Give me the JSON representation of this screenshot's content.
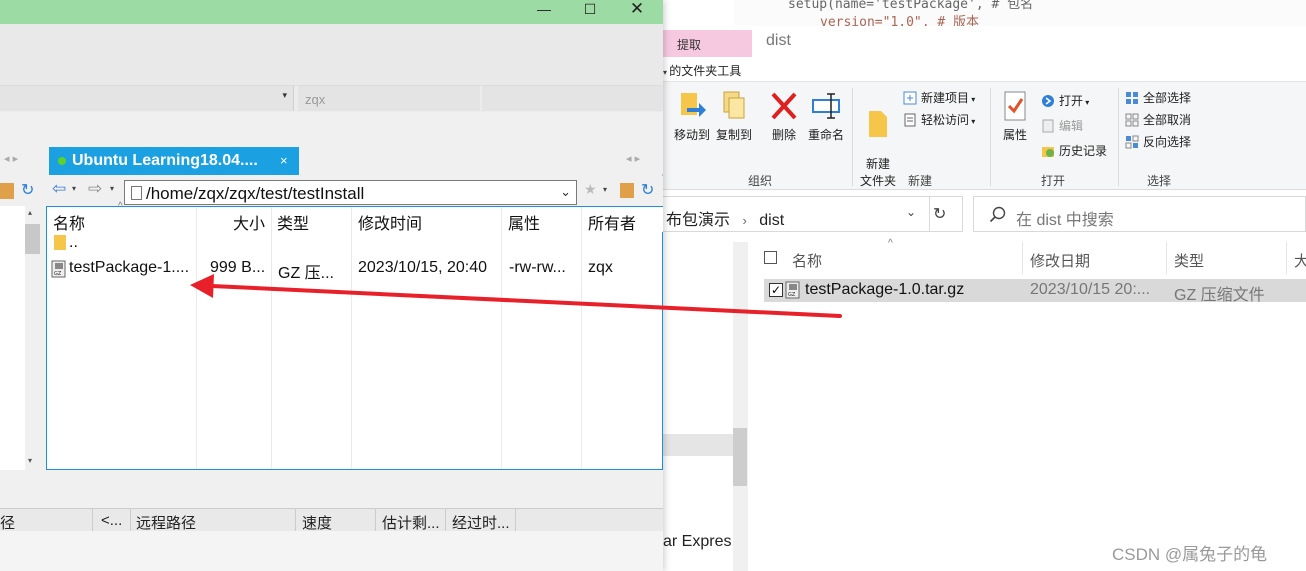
{
  "explorer": {
    "editor_line1": "setup(name='testPackage', # 包名",
    "editor_line2": "version=\"1.0\", # 版本",
    "ribbon_context_tab": "提取",
    "ribbon_context_sub": "的文件夹工具",
    "title": "dist",
    "ribbon": {
      "move_to": "移动到",
      "copy_to": "复制到",
      "delete": "删除",
      "rename": "重命名",
      "new_folder": "新建\n文件夹",
      "new_item": "新建项目",
      "easy_access": "轻松访问",
      "properties": "属性",
      "open": "打开",
      "edit": "编辑",
      "history": "历史记录",
      "select_all": "全部选择",
      "select_none": "全部取消",
      "invert_selection": "反向选择",
      "group_organize": "组织",
      "group_new": "新建",
      "group_open": "打开",
      "group_select": "选择"
    },
    "breadcrumb_parent": "布包演示",
    "breadcrumb_current": "dist",
    "search_placeholder": "在 dist 中搜索",
    "left_pane_item": "ar Expres",
    "columns": {
      "name": "名称",
      "modified": "修改日期",
      "type": "类型",
      "size": "大"
    },
    "file": {
      "name": "testPackage-1.0.tar.gz",
      "modified": "2023/10/15 20:...",
      "type": "GZ 压缩文件"
    }
  },
  "winscp": {
    "address_mid": "zqx",
    "session_tab": "Ubuntu Learning18.04....",
    "session_close": "×",
    "remote_path": "/home/zqx/zqx/test/testInstall",
    "columns": {
      "name": "名称",
      "size": "大小",
      "type": "类型",
      "modified": "修改时间",
      "rights": "属性",
      "owner": "所有者"
    },
    "rows": [
      {
        "name": "..",
        "size": "",
        "type": "",
        "modified": "",
        "rights": "",
        "owner": ""
      },
      {
        "name": "testPackage-1....",
        "size": "999 B...",
        "type": "GZ 压...",
        "modified": "2023/10/15, 20:40",
        "rights": "-rw-rw...",
        "owner": "zqx"
      }
    ],
    "queue_columns": [
      "径",
      "<...",
      "远程路径",
      "速度",
      "估计剩...",
      "经过时..."
    ]
  },
  "watermark": "CSDN @属兔子的龟",
  "colors": {
    "session_tab": "#1ba1e2",
    "titlebar": "#9ddba4",
    "arrow": "#e8202a",
    "context_tab": "#f7c9e1"
  }
}
